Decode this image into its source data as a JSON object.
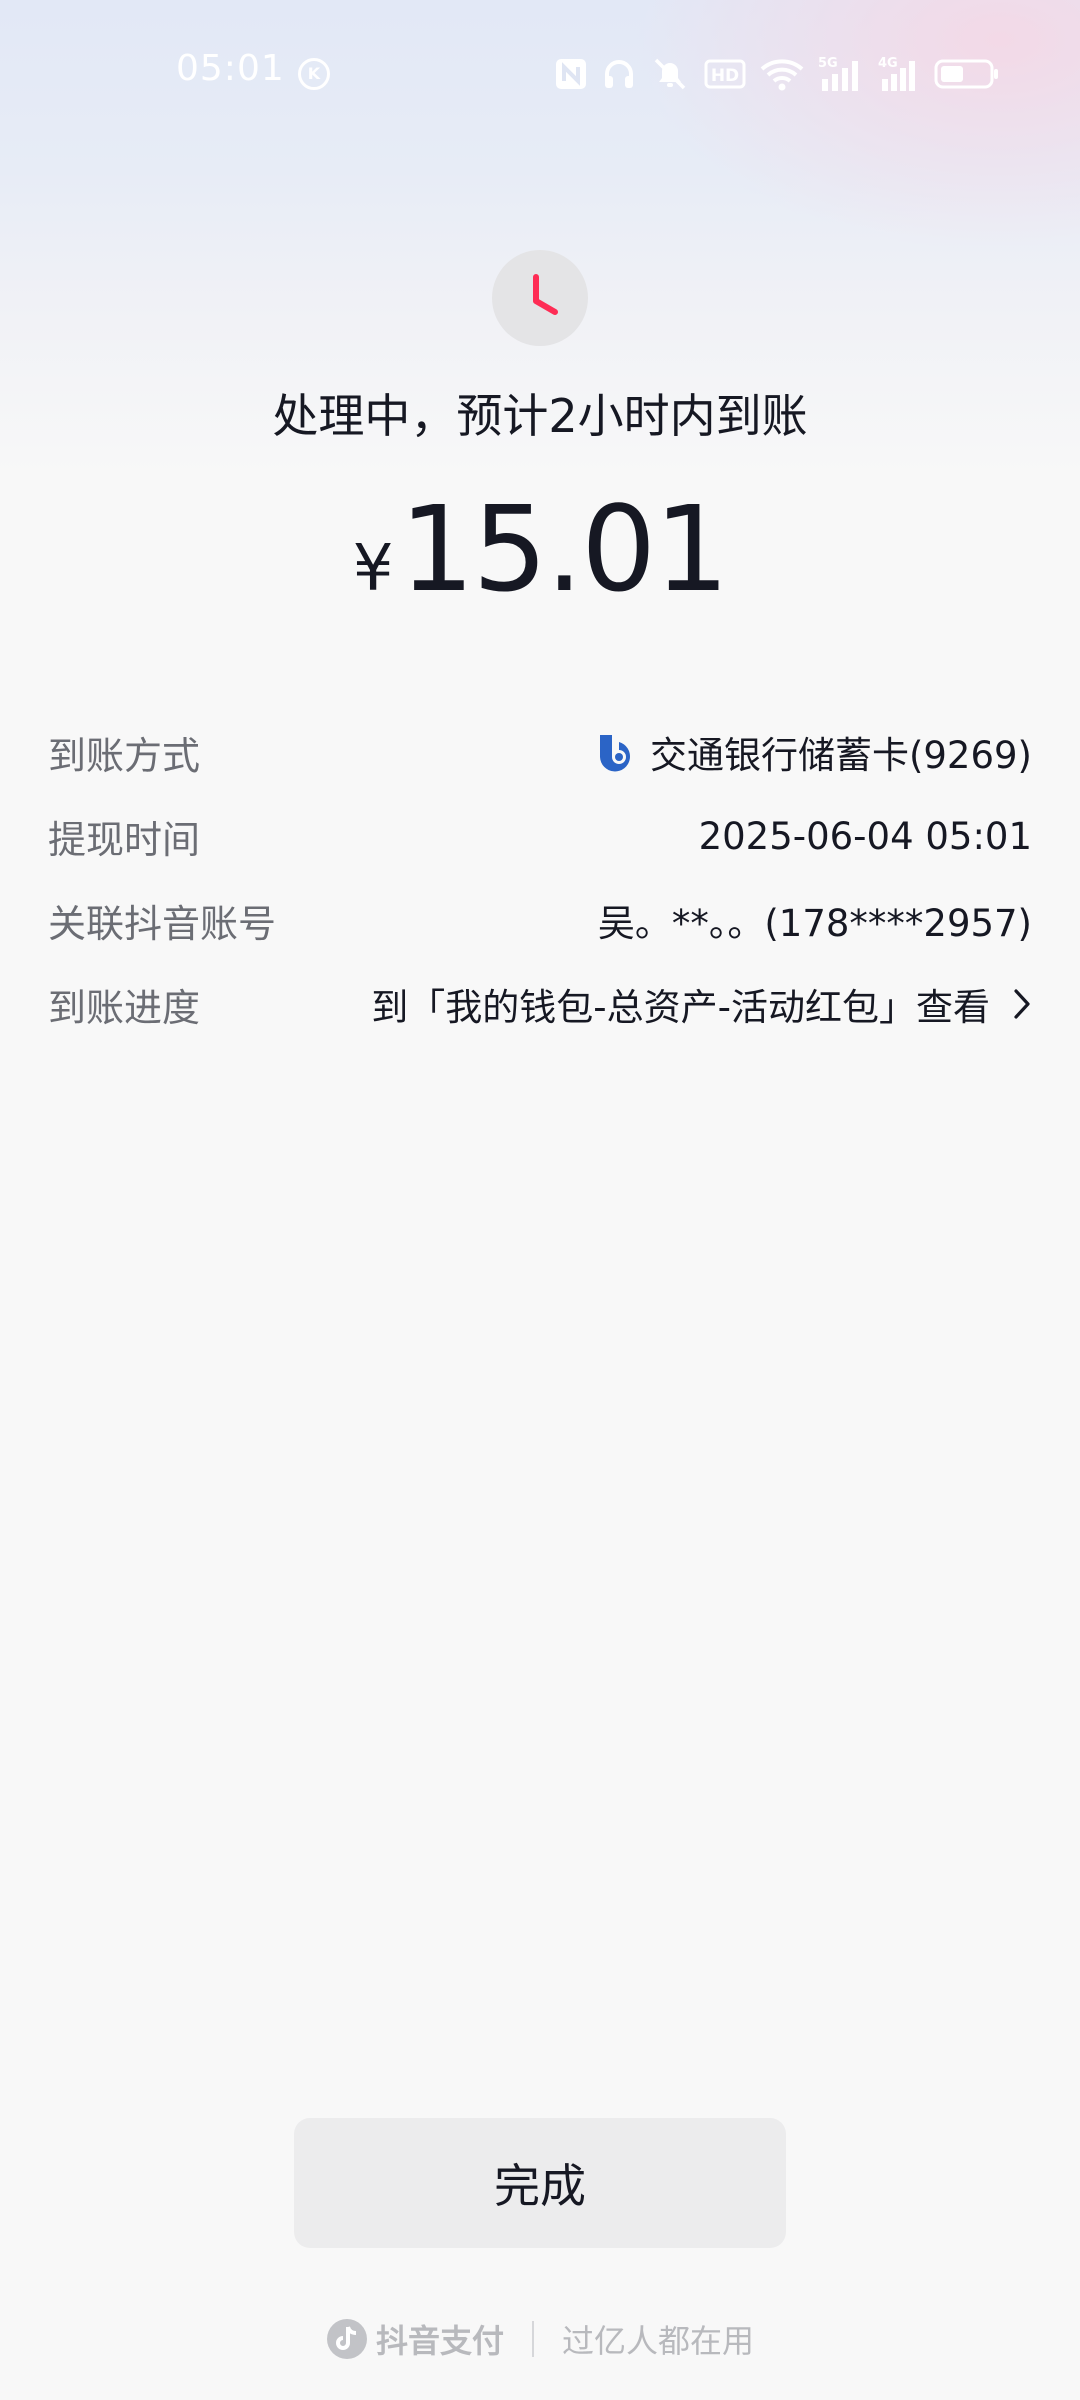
{
  "status_bar": {
    "time": "05:01",
    "k_badge": "K",
    "icons": [
      "nfc-icon",
      "headphones-icon",
      "mute-icon",
      "hd-icon",
      "wifi-icon",
      "signal-5g-icon",
      "signal-4g-icon",
      "battery-icon"
    ],
    "net_5g": "5G",
    "net_4g": "4G",
    "hd": "HD"
  },
  "result": {
    "icon": "clock-icon",
    "accent_color": "#fe2c55",
    "title": "处理中，预计2小时内到账",
    "currency": "¥",
    "amount": "15.01"
  },
  "details": [
    {
      "label": "到账方式",
      "value": "交通银行储蓄卡(9269)"
    },
    {
      "label": "提现时间",
      "value": "2025-06-04 05:01"
    },
    {
      "label": "关联抖音账号",
      "value": "吴。**。。(178****2957)"
    },
    {
      "label": "到账进度",
      "value": "到「我的钱包-总资产-活动红包」查看"
    }
  ],
  "done_button": "完成",
  "footer": {
    "brand": "抖音支付",
    "slogan": "过亿人都在用"
  }
}
